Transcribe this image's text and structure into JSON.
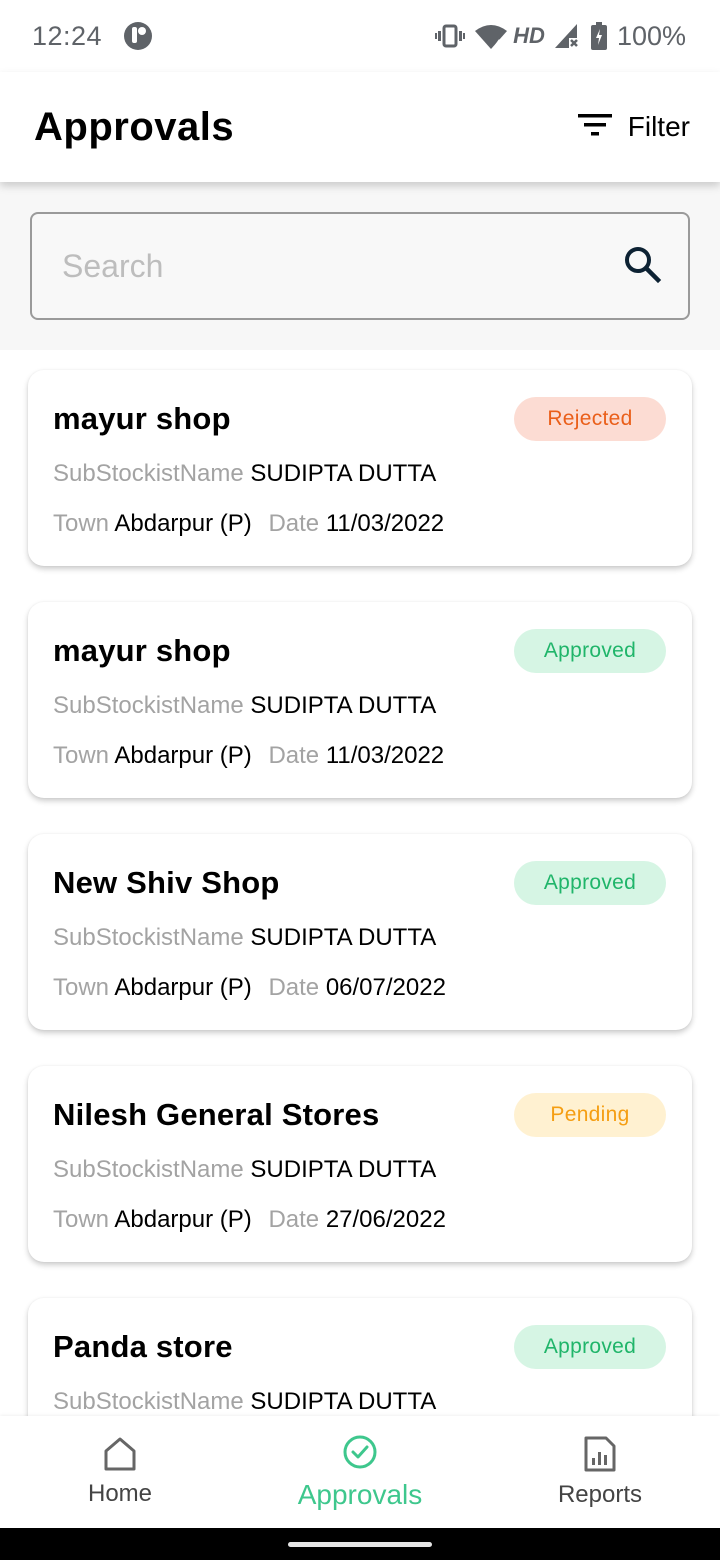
{
  "status_bar": {
    "time": "12:24",
    "network_label": "HD",
    "battery": "100%"
  },
  "header": {
    "title": "Approvals",
    "filter_label": "Filter"
  },
  "search": {
    "placeholder": "Search",
    "value": ""
  },
  "labels": {
    "substockist": "SubStockistName",
    "town": "Town",
    "date": "Date"
  },
  "approvals": [
    {
      "shop": "mayur shop",
      "status": "Rejected",
      "substockist": "SUDIPTA DUTTA",
      "town": "Abdarpur (P)",
      "date": "11/03/2022"
    },
    {
      "shop": "mayur shop",
      "status": "Approved",
      "substockist": "SUDIPTA DUTTA",
      "town": "Abdarpur (P)",
      "date": "11/03/2022"
    },
    {
      "shop": "New Shiv Shop",
      "status": "Approved",
      "substockist": "SUDIPTA DUTTA",
      "town": "Abdarpur (P)",
      "date": "06/07/2022"
    },
    {
      "shop": "Nilesh General Stores",
      "status": "Pending",
      "substockist": "SUDIPTA DUTTA",
      "town": "Abdarpur (P)",
      "date": "27/06/2022"
    },
    {
      "shop": "Panda store",
      "status": "Approved",
      "substockist": "SUDIPTA DUTTA",
      "town": "",
      "date": ""
    }
  ],
  "status_colors": {
    "Rejected": {
      "bg": "#fcdcd3",
      "fg": "#ea5f1a"
    },
    "Approved": {
      "bg": "#d6f5e4",
      "fg": "#20b56a"
    },
    "Pending": {
      "bg": "#fff1d1",
      "fg": "#f59e12"
    }
  },
  "bottom_nav": {
    "items": [
      {
        "label": "Home",
        "icon": "home-icon"
      },
      {
        "label": "Approvals",
        "icon": "check-circle-icon",
        "active": true
      },
      {
        "label": "Reports",
        "icon": "report-icon"
      }
    ],
    "accent": "#3ec78d"
  }
}
